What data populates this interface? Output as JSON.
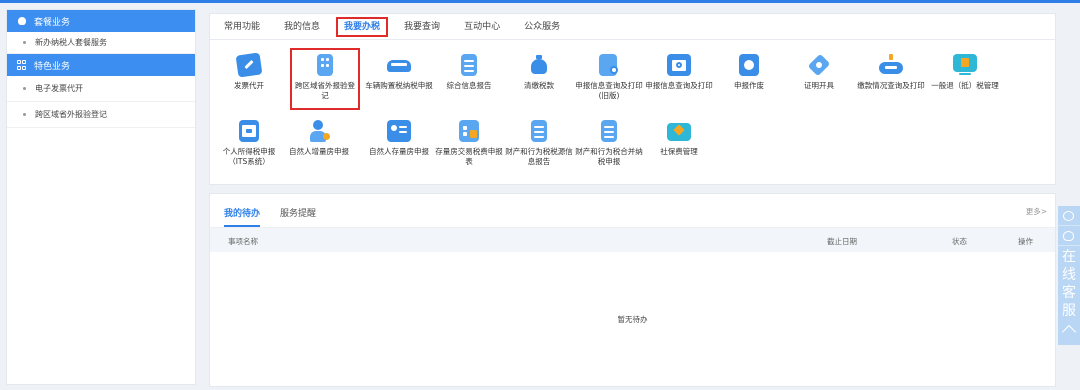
{
  "sidebar": {
    "package_header": "套餐业务",
    "package_items": [
      "新办纳税人套餐服务"
    ],
    "special_header": "特色业务",
    "special_items": [
      "电子发票代开",
      "跨区域省外报验登记"
    ]
  },
  "tabs": [
    "常用功能",
    "我的信息",
    "我要办税",
    "我要查询",
    "互动中心",
    "公众服务"
  ],
  "active_tab_index": 2,
  "functions_row1": [
    {
      "label": "发票代开",
      "icon": "edit-icon"
    },
    {
      "label": "跨区域省外报验登记",
      "icon": "building-icon"
    },
    {
      "label": "车辆购置税纳税申报",
      "icon": "car-icon"
    },
    {
      "label": "综合信息报告",
      "icon": "document-icon"
    },
    {
      "label": "清缴税款",
      "icon": "money-bag-icon"
    },
    {
      "label": "申报信息查询及打印(旧版)",
      "icon": "report-search-icon"
    },
    {
      "label": "申报信息查询及打印",
      "icon": "print-search-icon"
    },
    {
      "label": "申报作废",
      "icon": "cancel-icon"
    },
    {
      "label": "证明开具",
      "icon": "certificate-icon"
    },
    {
      "label": "缴款情况查询及打印",
      "icon": "payment-query-icon"
    },
    {
      "label": "一般退（抵）税管理",
      "icon": "refund-icon"
    }
  ],
  "functions_row2": [
    {
      "label": "个人所得税申报（ITS系统）",
      "icon": "tax-icon"
    },
    {
      "label": "自然人增量房申报",
      "icon": "person-add-icon"
    },
    {
      "label": "自然人存量房申报",
      "icon": "person-card-icon"
    },
    {
      "label": "存量房交易税费申报表",
      "icon": "house-tax-icon"
    },
    {
      "label": "财产和行为税税源信息报告",
      "icon": "property-source-icon"
    },
    {
      "label": "财产和行为税合并纳税申报",
      "icon": "property-merge-icon"
    },
    {
      "label": "社保费管理",
      "icon": "social-security-icon"
    }
  ],
  "todo": {
    "tabs": [
      "我的待办",
      "服务提醒"
    ],
    "more": "更多>",
    "columns": [
      "事项名称",
      "截止日期",
      "状态",
      "操作"
    ],
    "empty": "暂无待办"
  },
  "float": {
    "text": "在线客服"
  },
  "colors": {
    "accent": "#2f7fe8",
    "highlight": "#e02b2b",
    "sidebar_header": "#3c8ff0"
  }
}
